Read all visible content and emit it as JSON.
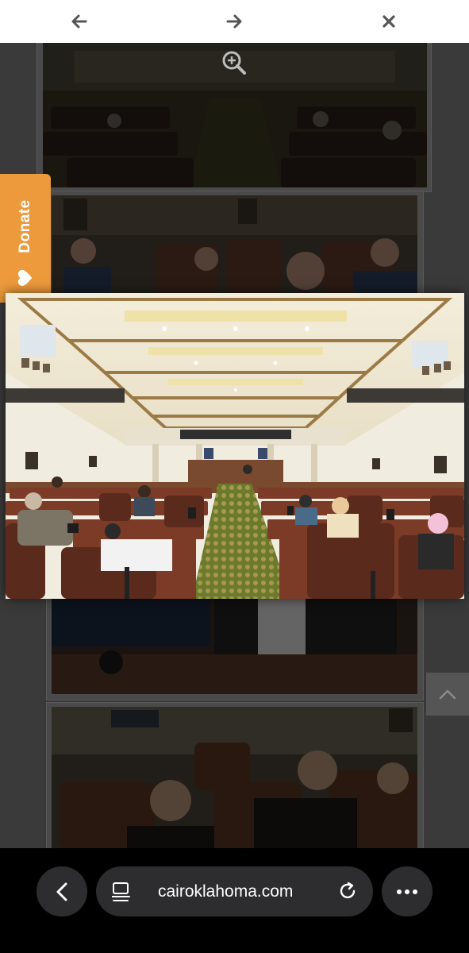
{
  "lightbox": {
    "prev_icon": "arrow-left-icon",
    "next_icon": "arrow-right-icon",
    "close_icon": "close-icon",
    "zoom_icon": "zoom-in-icon"
  },
  "donate": {
    "label": "Donate",
    "icon": "heart-icon",
    "color": "#ec9a3c"
  },
  "back_to_top": {
    "icon": "chevron-up-icon"
  },
  "browser": {
    "url": "cairoklahoma.com",
    "back_icon": "chevron-left-icon",
    "tabs_icon": "page-menu-icon",
    "reload_icon": "reload-icon",
    "more_icon": "more-icon"
  }
}
